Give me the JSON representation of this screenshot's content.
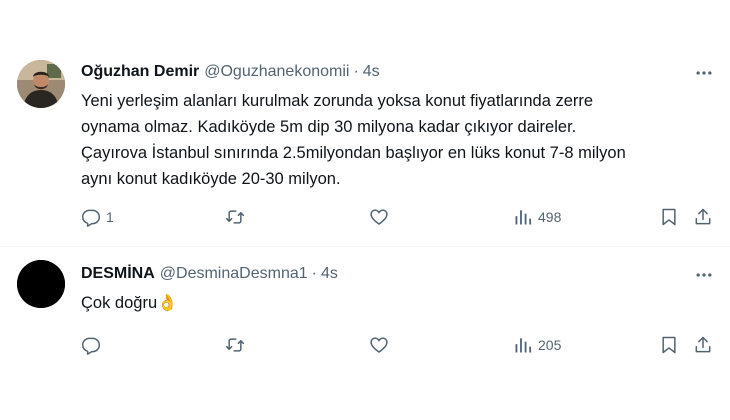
{
  "tweets": [
    {
      "name": "Oğuzhan Demir",
      "handle": "@Oguzhanekonomii",
      "separator": "·",
      "time": "4s",
      "text_lines": [
        "Yeni yerleşim alanları kurulmak zorunda yoksa konut fiyatlarında zerre",
        "oynama olmaz. Kadıköyde 5m dip 30 milyona kadar çıkıyor daireler.",
        "Çayırova İstanbul sınırında 2.5milyondan başlıyor en lüks konut 7-8 milyon",
        "aynı konut kadıköyde 20-30 milyon."
      ],
      "replies": "1",
      "retweets": "",
      "likes": "",
      "views": "498",
      "avatar_icon": "profile-photo"
    },
    {
      "name": "DESMİNA",
      "handle": "@DesminaDesmna1",
      "separator": "·",
      "time": "4s",
      "text_lines": [
        "Çok doğru👌"
      ],
      "replies": "",
      "retweets": "",
      "likes": "",
      "views": "205",
      "avatar_icon": "black-avatar"
    }
  ],
  "icons": {
    "reply": "reply-icon",
    "retweet": "retweet-icon",
    "like": "heart-icon",
    "views": "views-icon",
    "bookmark": "bookmark-icon",
    "share": "share-icon",
    "more": "more-icon"
  },
  "colors": {
    "text": "#0f1419",
    "secondary": "#536471",
    "divider": "#eff3f4"
  }
}
